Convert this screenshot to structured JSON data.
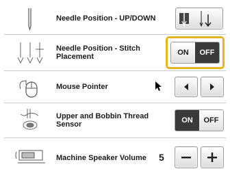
{
  "settings": [
    {
      "label": "Needle Position - UP/DOWN",
      "icon": "needle-icon"
    },
    {
      "label": "Needle Position - Stitch Placement",
      "icon": "needle-stitch-icon",
      "toggle": {
        "on": "ON",
        "off": "OFF",
        "selected": "OFF"
      }
    },
    {
      "label": "Mouse Pointer",
      "icon": "mouse-icon"
    },
    {
      "label": "Upper and Bobbin Thread Sensor",
      "icon": "thread-sensor-icon",
      "toggle": {
        "on": "ON",
        "off": "OFF",
        "selected": "ON"
      }
    },
    {
      "label": "Machine Speaker Volume",
      "icon": "speaker-icon",
      "value": "5"
    }
  ],
  "colors": {
    "highlight": "#e6b422",
    "selected_segment": "#3a3a3a"
  }
}
